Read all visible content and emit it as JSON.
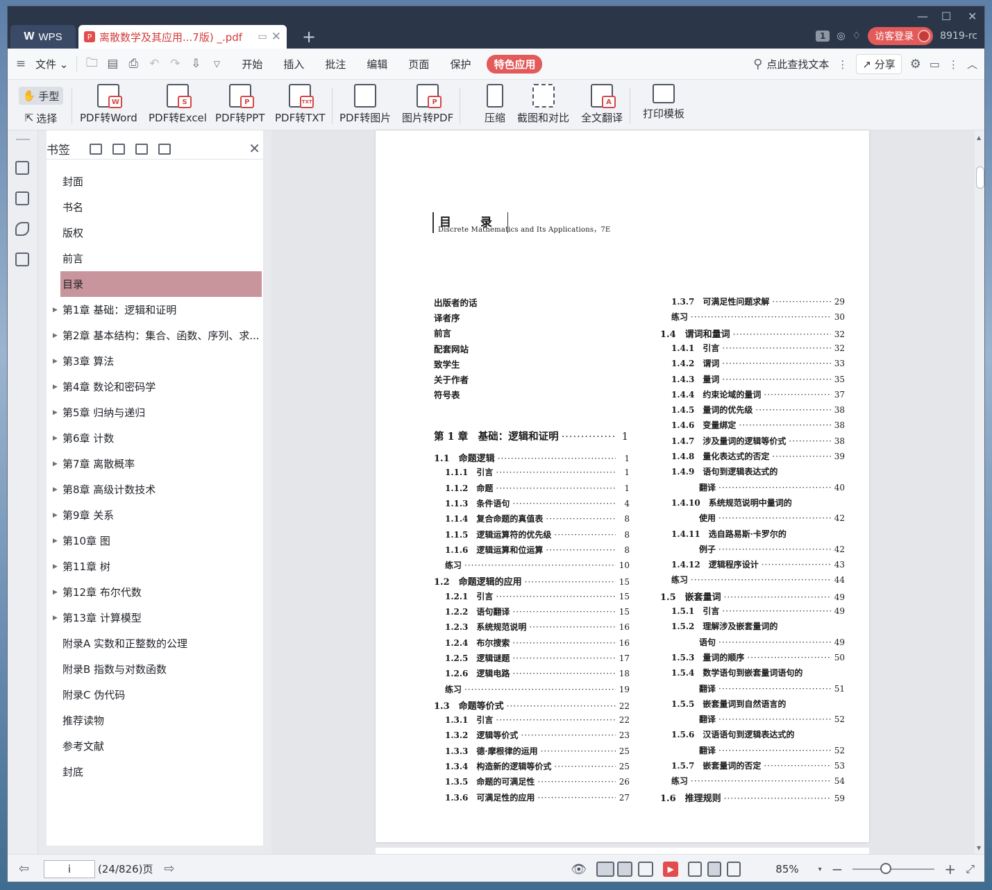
{
  "window": {
    "app_tab": "WPS",
    "doc_tab": "离散数学及其应用...7版)  _.pdf",
    "new_tab": "+",
    "tab_count": "1",
    "login": "访客登录",
    "user_id": "8919-rc"
  },
  "menu": {
    "file": "文件",
    "tabs": [
      "开始",
      "插入",
      "批注",
      "编辑",
      "页面",
      "保护"
    ],
    "active_tab": "特色应用",
    "search": "点此查找文本",
    "share": "分享"
  },
  "ribbon": {
    "hand": "手型",
    "select": "选择",
    "tools": [
      {
        "label": "PDF转Word",
        "mark": "W"
      },
      {
        "label": "PDF转Excel",
        "mark": "S"
      },
      {
        "label": "PDF转PPT",
        "mark": "P"
      },
      {
        "label": "PDF转TXT",
        "mark": "TXT"
      },
      {
        "label": "PDF转图片",
        "mark": ""
      },
      {
        "label": "图片转PDF",
        "mark": "P"
      },
      {
        "label": "压缩",
        "mark": ""
      },
      {
        "label": "截图和对比",
        "mark": ""
      },
      {
        "label": "全文翻译",
        "mark": "A"
      },
      {
        "label": "打印模板",
        "mark": ""
      }
    ]
  },
  "bookmarks": {
    "title": "书签",
    "items": [
      {
        "label": "封面",
        "expandable": false
      },
      {
        "label": "书名",
        "expandable": false
      },
      {
        "label": "版权",
        "expandable": false
      },
      {
        "label": "前言",
        "expandable": false
      },
      {
        "label": "目录",
        "expandable": false,
        "selected": true
      },
      {
        "label": "第1章 基础：逻辑和证明",
        "expandable": true
      },
      {
        "label": "第2章 基本结构：集合、函数、序列、求...",
        "expandable": true
      },
      {
        "label": "第3章 算法",
        "expandable": true
      },
      {
        "label": "第4章 数论和密码学",
        "expandable": true
      },
      {
        "label": "第5章 归纳与递归",
        "expandable": true
      },
      {
        "label": "第6章 计数",
        "expandable": true
      },
      {
        "label": "第7章 离散概率",
        "expandable": true
      },
      {
        "label": "第8章 高级计数技术",
        "expandable": true
      },
      {
        "label": "第9章 关系",
        "expandable": true
      },
      {
        "label": "第10章 图",
        "expandable": true
      },
      {
        "label": "第11章 树",
        "expandable": true
      },
      {
        "label": "第12章 布尔代数",
        "expandable": true
      },
      {
        "label": "第13章 计算模型",
        "expandable": true
      },
      {
        "label": "附录A 实数和正整数的公理",
        "expandable": false
      },
      {
        "label": "附录B 指数与对数函数",
        "expandable": false
      },
      {
        "label": "附录C 伪代码",
        "expandable": false
      },
      {
        "label": "推荐读物",
        "expandable": false
      },
      {
        "label": "参考文献",
        "expandable": false
      },
      {
        "label": "封底",
        "expandable": false
      }
    ]
  },
  "page": {
    "title": "目 录",
    "subtitle": "Discrete Mathematics and Its Applications，7E",
    "front_matter": [
      "出版者的话",
      "译者序",
      "前言",
      "配套网站",
      "致学生",
      "关于作者",
      "符号表"
    ],
    "chapter": {
      "label": "第 1 章　基础：逻辑和证明",
      "page": "1"
    },
    "left_col": [
      {
        "label": "1.1　命题逻辑",
        "page": "1",
        "indent": 1
      },
      {
        "label": "1.1.1　引言",
        "page": "1",
        "indent": 2
      },
      {
        "label": "1.1.2　命题",
        "page": "1",
        "indent": 2
      },
      {
        "label": "1.1.3　条件语句",
        "page": "4",
        "indent": 2
      },
      {
        "label": "1.1.4　复合命题的真值表",
        "page": "8",
        "indent": 2
      },
      {
        "label": "1.1.5　逻辑运算符的优先级",
        "page": "8",
        "indent": 2
      },
      {
        "label": "1.1.6　逻辑运算和位运算",
        "page": "8",
        "indent": 2
      },
      {
        "label": "练习",
        "page": "10",
        "indent": 2
      },
      {
        "label": "1.2　命题逻辑的应用",
        "page": "15",
        "indent": 1
      },
      {
        "label": "1.2.1　引言",
        "page": "15",
        "indent": 2
      },
      {
        "label": "1.2.2　语句翻译",
        "page": "15",
        "indent": 2
      },
      {
        "label": "1.2.3　系统规范说明",
        "page": "16",
        "indent": 2
      },
      {
        "label": "1.2.4　布尔搜索",
        "page": "16",
        "indent": 2
      },
      {
        "label": "1.2.5　逻辑谜题",
        "page": "17",
        "indent": 2
      },
      {
        "label": "1.2.6　逻辑电路",
        "page": "18",
        "indent": 2
      },
      {
        "label": "练习",
        "page": "19",
        "indent": 2
      },
      {
        "label": "1.3　命题等价式",
        "page": "22",
        "indent": 1
      },
      {
        "label": "1.3.1　引言",
        "page": "22",
        "indent": 2
      },
      {
        "label": "1.3.2　逻辑等价式",
        "page": "23",
        "indent": 2
      },
      {
        "label": "1.3.3　德·摩根律的运用",
        "page": "25",
        "indent": 2
      },
      {
        "label": "1.3.4　构造新的逻辑等价式",
        "page": "25",
        "indent": 2
      },
      {
        "label": "1.3.5　命题的可满足性",
        "page": "26",
        "indent": 2
      },
      {
        "label": "1.3.6　可满足性的应用",
        "page": "27",
        "indent": 2
      }
    ],
    "right_col": [
      {
        "label": "1.3.7　可满足性问题求解",
        "page": "29",
        "indent": 2
      },
      {
        "label": "练习",
        "page": "30",
        "indent": 2
      },
      {
        "label": "1.4　谓词和量词",
        "page": "32",
        "indent": 1
      },
      {
        "label": "1.4.1　引言",
        "page": "32",
        "indent": 2
      },
      {
        "label": "1.4.2　谓词",
        "page": "33",
        "indent": 2
      },
      {
        "label": "1.4.3　量词",
        "page": "35",
        "indent": 2
      },
      {
        "label": "1.4.4　约束论域的量词",
        "page": "37",
        "indent": 2
      },
      {
        "label": "1.4.5　量词的优先级",
        "page": "38",
        "indent": 2
      },
      {
        "label": "1.4.6　变量绑定",
        "page": "38",
        "indent": 2
      },
      {
        "label": "1.4.7　涉及量词的逻辑等价式",
        "page": "38",
        "indent": 2
      },
      {
        "label": "1.4.8　量化表达式的否定",
        "page": "39",
        "indent": 2
      },
      {
        "label": "1.4.9　语句到逻辑表达式的",
        "page": "",
        "indent": 2
      },
      {
        "label": "翻译",
        "page": "40",
        "indent": 3
      },
      {
        "label": "1.4.10　系统规范说明中量词的",
        "page": "",
        "indent": 2
      },
      {
        "label": "使用",
        "page": "42",
        "indent": 3
      },
      {
        "label": "1.4.11　选自路易斯·卡罗尔的",
        "page": "",
        "indent": 2
      },
      {
        "label": "例子",
        "page": "42",
        "indent": 3
      },
      {
        "label": "1.4.12　逻辑程序设计",
        "page": "43",
        "indent": 2
      },
      {
        "label": "练习",
        "page": "44",
        "indent": 2
      },
      {
        "label": "1.5　嵌套量词",
        "page": "49",
        "indent": 1
      },
      {
        "label": "1.5.1　引言",
        "page": "49",
        "indent": 2
      },
      {
        "label": "1.5.2　理解涉及嵌套量词的",
        "page": "",
        "indent": 2
      },
      {
        "label": "语句",
        "page": "49",
        "indent": 3
      },
      {
        "label": "1.5.3　量词的顺序",
        "page": "50",
        "indent": 2
      },
      {
        "label": "1.5.4　数学语句到嵌套量词语句的",
        "page": "",
        "indent": 2
      },
      {
        "label": "翻译",
        "page": "51",
        "indent": 3
      },
      {
        "label": "1.5.5　嵌套量词到自然语言的",
        "page": "",
        "indent": 2
      },
      {
        "label": "翻译",
        "page": "52",
        "indent": 3
      },
      {
        "label": "1.5.6　汉语语句到逻辑表达式的",
        "page": "",
        "indent": 2
      },
      {
        "label": "翻译",
        "page": "52",
        "indent": 3
      },
      {
        "label": "1.5.7　嵌套量词的否定",
        "page": "53",
        "indent": 2
      },
      {
        "label": "练习",
        "page": "54",
        "indent": 2
      },
      {
        "label": "1.6　推理规则",
        "page": "59",
        "indent": 1
      }
    ]
  },
  "status": {
    "page_input": "i",
    "page_info": "(24/826)页",
    "zoom": "85%",
    "zoom_fraction": 0.4
  }
}
